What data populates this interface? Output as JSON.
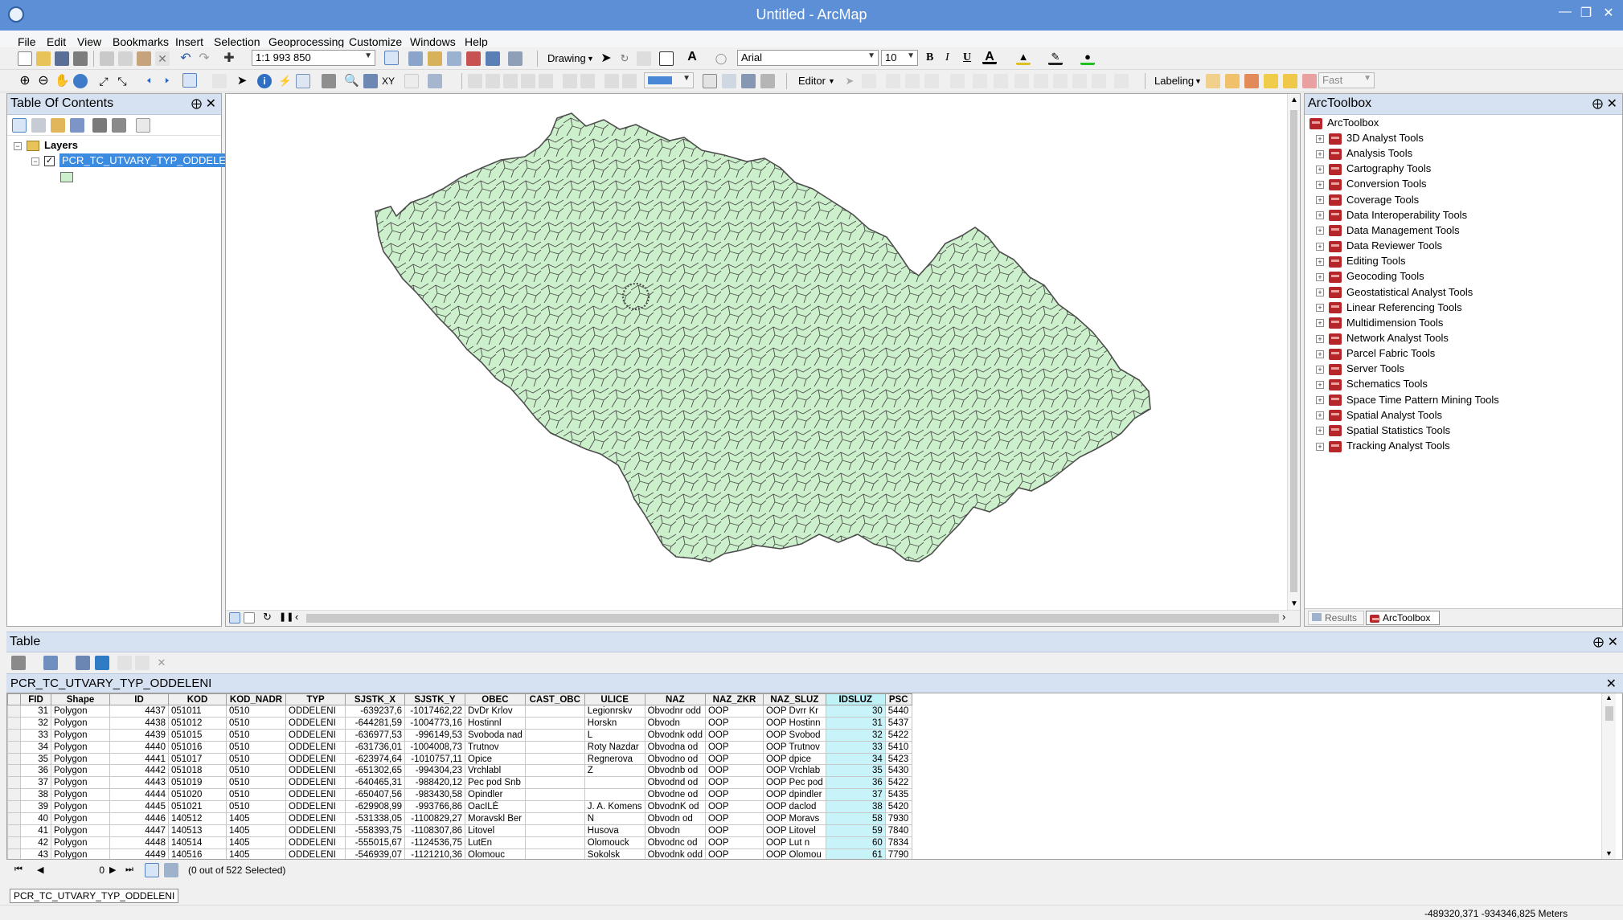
{
  "window": {
    "title": "Untitled - ArcMap"
  },
  "menu": [
    "File",
    "Edit",
    "View",
    "Bookmarks",
    "Insert",
    "Selection",
    "Geoprocessing",
    "Customize",
    "Windows",
    "Help"
  ],
  "toolbar": {
    "scale": "1:1 993 850",
    "drawing_label": "Drawing",
    "font_name": "Arial",
    "font_size": "10",
    "bold": "B",
    "italic": "I",
    "underline": "U",
    "editor_label": "Editor",
    "labeling_label": "Labeling",
    "fast_label": "Fast"
  },
  "toc": {
    "title": "Table Of Contents",
    "layers_label": "Layers",
    "layer_name": "PCR_TC_UTVARY_TYP_ODDELENI"
  },
  "toolbox": {
    "title": "ArcToolbox",
    "root": "ArcToolbox",
    "items": [
      "3D Analyst Tools",
      "Analysis Tools",
      "Cartography Tools",
      "Conversion Tools",
      "Coverage Tools",
      "Data Interoperability Tools",
      "Data Management Tools",
      "Data Reviewer Tools",
      "Editing Tools",
      "Geocoding Tools",
      "Geostatistical Analyst Tools",
      "Linear Referencing Tools",
      "Multidimension Tools",
      "Network Analyst Tools",
      "Parcel Fabric Tools",
      "Server Tools",
      "Schematics Tools",
      "Space Time Pattern Mining Tools",
      "Spatial Analyst Tools",
      "Spatial Statistics Tools",
      "Tracking Analyst Tools"
    ],
    "tab_results": "Results",
    "tab_arctoolbox": "ArcToolbox"
  },
  "table": {
    "pane_title": "Table",
    "layer_title": "PCR_TC_UTVARY_TYP_ODDELENI",
    "columns": [
      "FID",
      "Shape",
      "ID",
      "KOD",
      "KOD_NADR",
      "TYP",
      "SJSTK_X",
      "SJSTK_Y",
      "OBEC",
      "CAST_OBC",
      "ULICE",
      "NAZ",
      "NAZ_ZKR",
      "NAZ_SLUZ",
      "IDSLUZ",
      "PSC"
    ],
    "rows": [
      [
        "31",
        "Polygon",
        "4437",
        "051011",
        "0510",
        "ODDELENI",
        "-639237,6",
        "-1017462,22",
        "DvDr Krlov",
        "",
        "Legionrskv",
        "Obvodnr odd",
        "OOP",
        "OOP Dvrr Kr",
        "30",
        "5440"
      ],
      [
        "32",
        "Polygon",
        "4438",
        "051012",
        "0510",
        "ODDELENI",
        "-644281,59",
        "-1004773,16",
        "Hostinnl",
        "",
        "Horskn",
        "Obvodn",
        "OOP",
        "OOP Hostinn",
        "31",
        "5437"
      ],
      [
        "33",
        "Polygon",
        "4439",
        "051015",
        "0510",
        "ODDELENI",
        "-636977,53",
        "-996149,53",
        "Svoboda nad",
        "",
        "L",
        "Obvodnk odd",
        "OOP",
        "OOP Svobod",
        "32",
        "5422"
      ],
      [
        "34",
        "Polygon",
        "4440",
        "051016",
        "0510",
        "ODDELENI",
        "-631736,01",
        "-1004008,73",
        "Trutnov",
        "",
        "Roty Nazdar",
        "Obvodna od",
        "OOP",
        "OOP Trutnov",
        "33",
        "5410"
      ],
      [
        "35",
        "Polygon",
        "4441",
        "051017",
        "0510",
        "ODDELENI",
        "-623974,64",
        "-1010757,11",
        "Opice",
        "",
        "Regnerova",
        "Obvodno od",
        "OOP",
        "OOP dpice",
        "34",
        "5423"
      ],
      [
        "36",
        "Polygon",
        "4442",
        "051018",
        "0510",
        "ODDELENI",
        "-651302,65",
        "-994304,23",
        "Vrchlabl",
        "",
        "Z",
        "Obvodnb od",
        "OOP",
        "OOP Vrchlab",
        "35",
        "5430"
      ],
      [
        "37",
        "Polygon",
        "4443",
        "051019",
        "0510",
        "ODDELENI",
        "-640465,31",
        "-988420,12",
        "Pec pod Snb",
        "",
        "",
        "Obvodnd od",
        "OOP",
        "OOP Pec pod",
        "36",
        "5422"
      ],
      [
        "38",
        "Polygon",
        "4444",
        "051020",
        "0510",
        "ODDELENI",
        "-650407,56",
        "-983430,58",
        "Opindler",
        "",
        "",
        "Obvodne od",
        "OOP",
        "OOP dpindler",
        "37",
        "5435"
      ],
      [
        "39",
        "Polygon",
        "4445",
        "051021",
        "0510",
        "ODDELENI",
        "-629908,99",
        "-993766,86",
        "OacILÉ",
        "",
        "J. A. Komens",
        "ObvodnK od",
        "OOP",
        "OOP daclod",
        "38",
        "5420"
      ],
      [
        "40",
        "Polygon",
        "4446",
        "140512",
        "1405",
        "ODDELENI",
        "-531338,05",
        "-1100829,27",
        "Moravskl Ber",
        "",
        "N",
        "Obvodn od",
        "OOP",
        "OOP Moravs",
        "58",
        "7930"
      ],
      [
        "41",
        "Polygon",
        "4447",
        "140513",
        "1405",
        "ODDELENI",
        "-558393,75",
        "-1108307,86",
        "Litovel",
        "",
        "Husova",
        "Obvodn",
        "OOP",
        "OOP Litovel",
        "59",
        "7840"
      ],
      [
        "42",
        "Polygon",
        "4448",
        "140514",
        "1405",
        "ODDELENI",
        "-555015,67",
        "-1124536,75",
        "LutEn",
        "",
        "Olomouck",
        "Obvodnc od",
        "OOP",
        "OOP Lut n",
        "60",
        "7834"
      ],
      [
        "43",
        "Polygon",
        "4449",
        "140516",
        "1405",
        "ODDELENI",
        "-546939,07",
        "-1121210,36",
        "Olomouc",
        "",
        "Sokolsk",
        "Obvodnk odd",
        "OOP",
        "OOP Olomou",
        "61",
        "7790"
      ]
    ],
    "record_index": "0",
    "selection_status": "(0 out of 522 Selected)",
    "bottom_tab": "PCR_TC_UTVARY_TYP_ODDELENI"
  },
  "statusbar": {
    "coordinates": "-489320,371  -934346,825 Meters"
  },
  "colors": {
    "title_bar": "#5c8fd6",
    "map_fill": "#ccf0cb",
    "map_stroke": "#4d4d4d",
    "selected_col": "#c8f4f9",
    "panel_header": "#d6e2f2"
  }
}
